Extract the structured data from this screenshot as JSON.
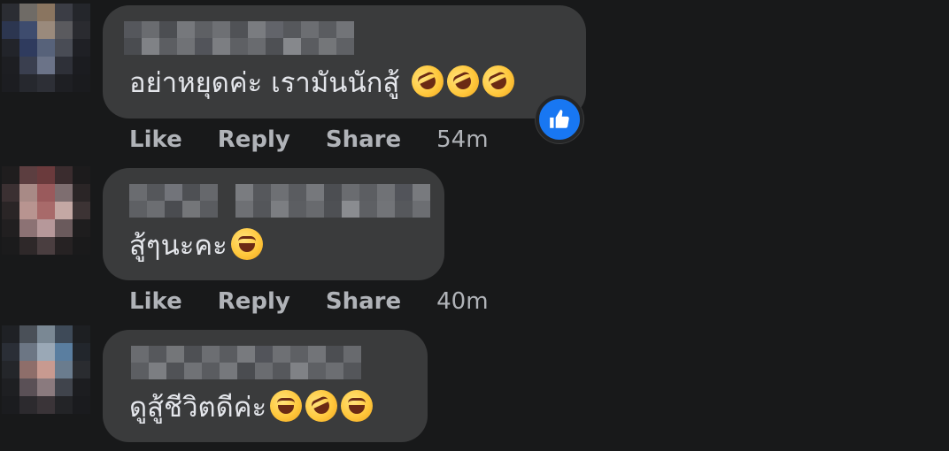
{
  "comments": [
    {
      "text": "อย่าหยุดค่ะ เรามันนักสู้",
      "emojis": [
        "rolling-on-floor-laughing",
        "rolling-on-floor-laughing",
        "rolling-on-floor-laughing"
      ],
      "has_like_reaction": true,
      "actions": {
        "like": "Like",
        "reply": "Reply",
        "share": "Share"
      },
      "time": "54m"
    },
    {
      "text": "สู้ๆนะคะ",
      "emojis": [
        "grinning-face-with-smiling-eyes"
      ],
      "has_like_reaction": false,
      "actions": {
        "like": "Like",
        "reply": "Reply",
        "share": "Share"
      },
      "time": "40m"
    },
    {
      "text": "ดูสู้ชีวิตดีค่ะ",
      "emojis": [
        "face-with-tears-of-joy",
        "rolling-on-floor-laughing",
        "grinning-squinting-face"
      ],
      "has_like_reaction": false,
      "actions": null,
      "time": null
    }
  ],
  "colors": {
    "background": "#18191a",
    "bubble": "#3a3b3c",
    "text": "#e4e6eb",
    "secondary_text": "#b0b3b8",
    "like_blue": "#1877f2"
  }
}
